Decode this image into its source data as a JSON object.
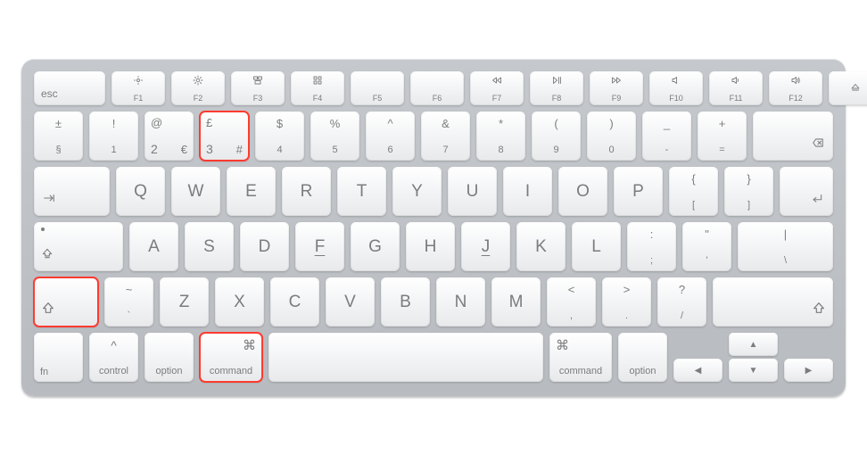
{
  "keyboard_type": "Apple Magic Keyboard (UK layout)",
  "highlighted_keys": [
    "key-3",
    "left-shift",
    "left-command"
  ],
  "rows": {
    "function": {
      "esc": {
        "label": "esc"
      },
      "f1": {
        "icon": "brightness-down",
        "label": "F1"
      },
      "f2": {
        "icon": "brightness-up",
        "label": "F2"
      },
      "f3": {
        "icon": "mission-control",
        "label": "F3"
      },
      "f4": {
        "icon": "launchpad",
        "label": "F4"
      },
      "f5": {
        "label": "F5"
      },
      "f6": {
        "label": "F6"
      },
      "f7": {
        "icon": "rewind",
        "label": "F7"
      },
      "f8": {
        "icon": "playpause",
        "label": "F8"
      },
      "f9": {
        "icon": "ffwd",
        "label": "F9"
      },
      "f10": {
        "icon": "mute",
        "label": "F10"
      },
      "f11": {
        "icon": "voldown",
        "label": "F11"
      },
      "f12": {
        "icon": "volup",
        "label": "F12"
      },
      "eject": {
        "icon": "eject"
      }
    },
    "number": {
      "section": {
        "top": "±",
        "bottom": "§"
      },
      "1": {
        "top": "!",
        "bottom": "1"
      },
      "2": {
        "top": "@",
        "bottom": "2",
        "right": "€"
      },
      "3": {
        "top": "£",
        "bottom": "3",
        "right": "#"
      },
      "4": {
        "top": "$",
        "bottom": "4"
      },
      "5": {
        "top": "%",
        "bottom": "5"
      },
      "6": {
        "top": "^",
        "bottom": "6"
      },
      "7": {
        "top": "&",
        "bottom": "7"
      },
      "8": {
        "top": "*",
        "bottom": "8"
      },
      "9": {
        "top": "(",
        "bottom": "9"
      },
      "0": {
        "top": ")",
        "bottom": "0"
      },
      "minus": {
        "top": "_",
        "bottom": "-"
      },
      "equal": {
        "top": "+",
        "bottom": "="
      },
      "delete": {
        "icon": "delete-back"
      }
    },
    "qwerty": {
      "tab": {
        "icon": "tab"
      },
      "letters": [
        "Q",
        "W",
        "E",
        "R",
        "T",
        "Y",
        "U",
        "I",
        "O",
        "P"
      ],
      "lbracket": {
        "top": "{",
        "bottom": "["
      },
      "rbracket": {
        "top": "}",
        "bottom": "]"
      },
      "return": {
        "icon": "return"
      }
    },
    "asdf": {
      "caps": {
        "icon": "caps",
        "dot": true
      },
      "letters": [
        "A",
        "S",
        "D",
        "F",
        "G",
        "H",
        "J",
        "K",
        "L"
      ],
      "semicolon": {
        "top": ":",
        "bottom": ";"
      },
      "quote": {
        "top": "\"",
        "bottom": "'"
      },
      "backslash": {
        "top": "|",
        "bottom": "\\"
      }
    },
    "zxcv": {
      "lshift": {
        "icon": "shift"
      },
      "backtick": {
        "top": "~",
        "bottom": "`"
      },
      "letters": [
        "Z",
        "X",
        "C",
        "V",
        "B",
        "N",
        "M"
      ],
      "comma": {
        "top": "<",
        "bottom": ","
      },
      "period": {
        "top": ">",
        "bottom": "."
      },
      "slash": {
        "top": "?",
        "bottom": "/"
      },
      "rshift": {
        "icon": "shift"
      }
    },
    "bottom": {
      "fn": {
        "label": "fn"
      },
      "control": {
        "label": "control",
        "symbol": "^"
      },
      "loption": {
        "label": "option"
      },
      "lcommand": {
        "label": "command",
        "symbol": "⌘"
      },
      "space": {
        "label": ""
      },
      "rcommand": {
        "label": "command",
        "symbol": "⌘"
      },
      "roption": {
        "label": "option"
      },
      "left": {
        "icon": "◄"
      },
      "up": {
        "icon": "▲"
      },
      "down": {
        "icon": "▼"
      },
      "right": {
        "icon": "►"
      }
    }
  }
}
